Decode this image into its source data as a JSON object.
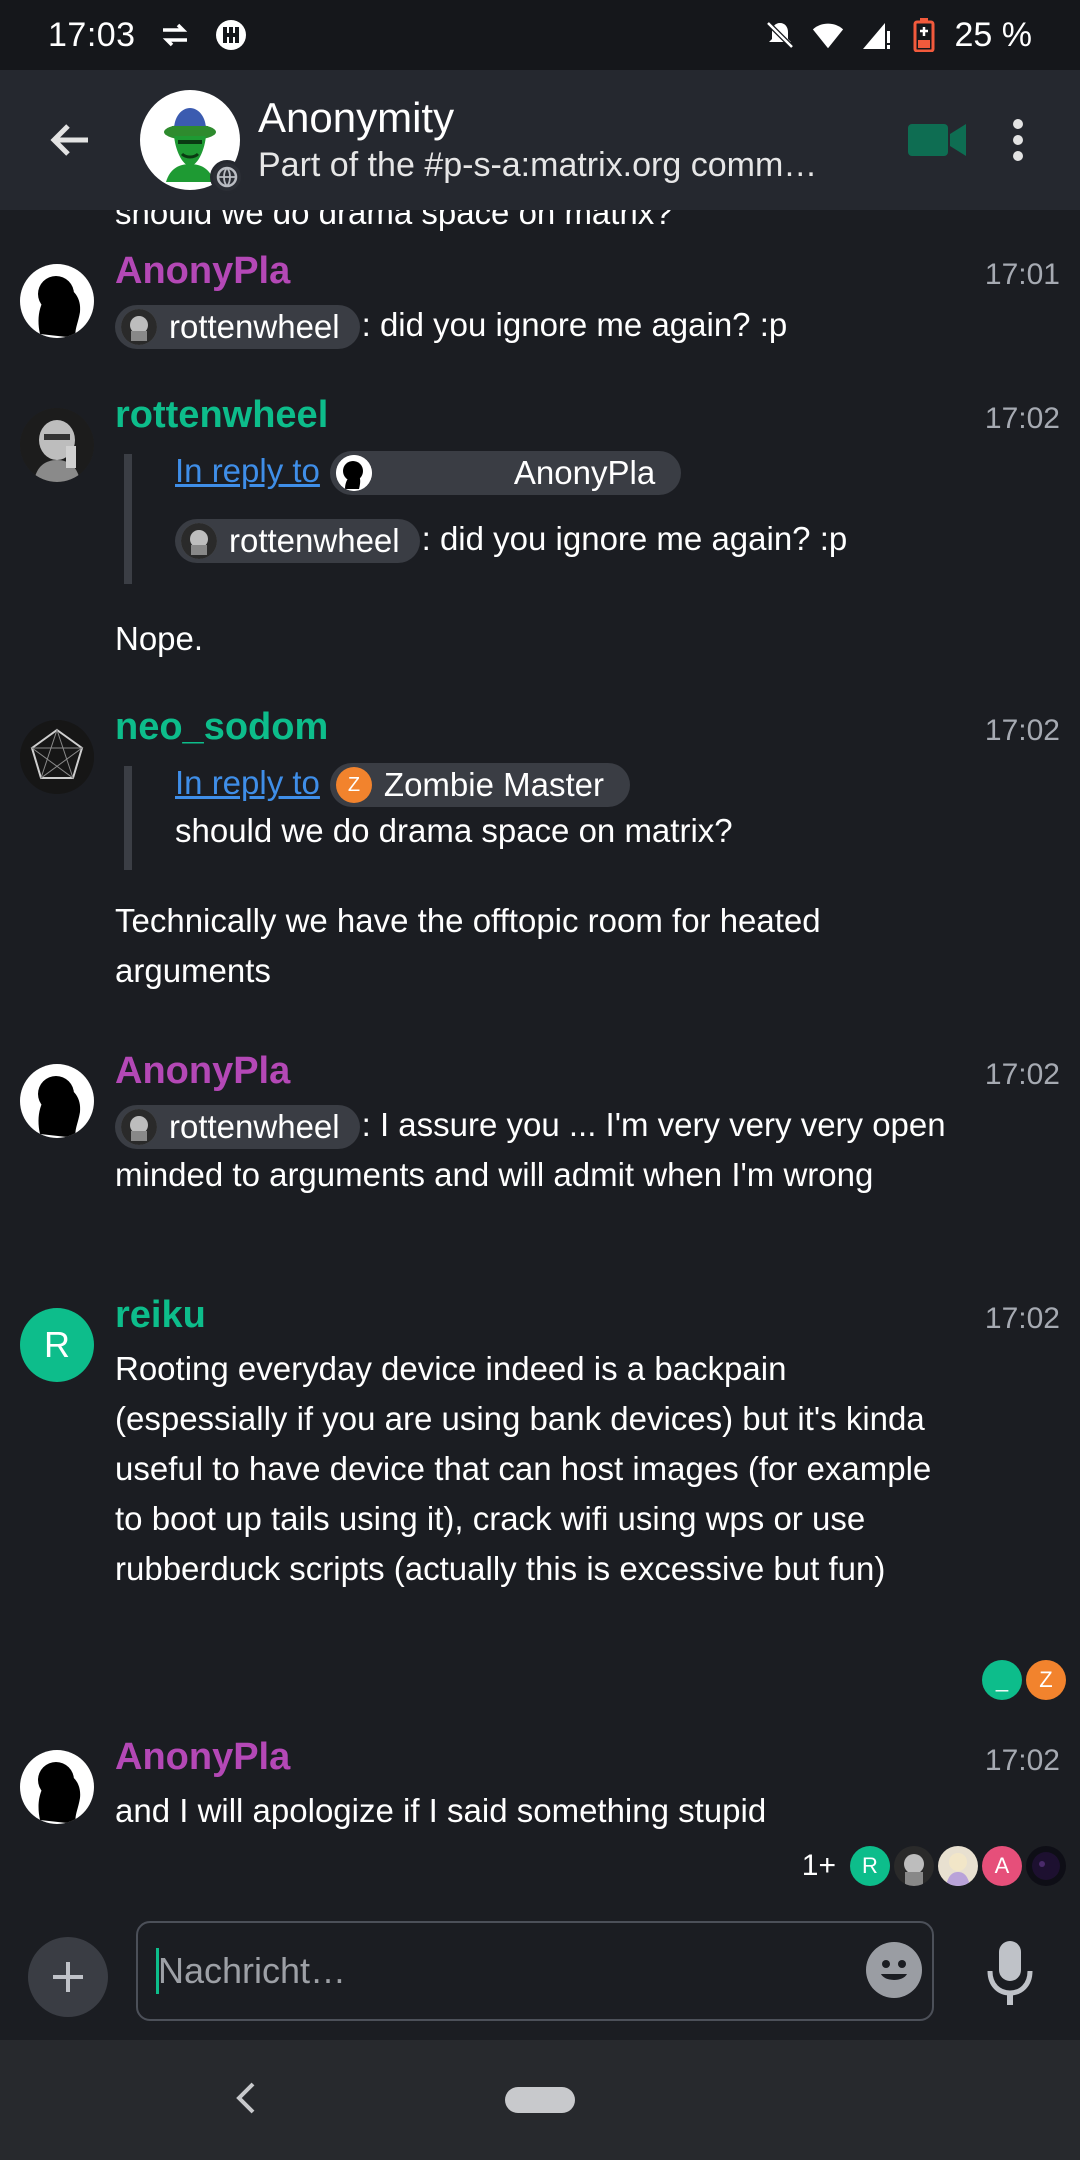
{
  "status_bar": {
    "time": "17:03",
    "battery": "25 %"
  },
  "header": {
    "room_name": "Anonymity",
    "topic": "Part of the #p-s-a:matrix.org comm…"
  },
  "timeline": {
    "cut_text": "should we do drama space on matrix?",
    "messages": [
      {
        "sender": "AnonyPla",
        "time": "17:01",
        "mention": "rottenwheel",
        "text": ": did you ignore me again? :p"
      },
      {
        "sender": "rottenwheel",
        "time": "17:02",
        "reply_link": "In reply to",
        "reply_sender": "AnonyPla",
        "reply_mention": "rottenwheel",
        "reply_text": ": did you ignore me again? :p",
        "text": "Nope."
      },
      {
        "sender": "neo_sodom",
        "time": "17:02",
        "reply_link": "In reply to",
        "reply_sender": "Zombie Master",
        "reply_sender_initial": "Z",
        "reply_text": "should we do drama space on matrix?",
        "text": "Technically we have the offtopic room for heated arguments"
      },
      {
        "sender": "AnonyPla",
        "time": "17:02",
        "mention": "rottenwheel",
        "text": ": I assure you ... I'm very very very open minded to arguments and will admit when I'm wrong"
      },
      {
        "sender": "reiku",
        "time": "17:02",
        "avatar_initial": "R",
        "text": "Rooting everyday device indeed is a backpain (espessially if you are using bank devices) but it's kinda useful to have device that can host images (for example to boot up tails using it), crack wifi using wps or use rubberduck scripts (actually this is excessive but fun)",
        "receipts": [
          "_",
          "Z"
        ]
      },
      {
        "sender": "AnonyPla",
        "time": "17:02",
        "text": "and I will apologize if I said something stupid",
        "receipts_more": "1+",
        "receipts": [
          "R",
          "",
          "",
          "A",
          ""
        ]
      }
    ]
  },
  "composer": {
    "placeholder": "Nachricht…"
  },
  "colors": {
    "anonypla": "#b448b6",
    "green_user": "#0dbd8b",
    "link": "#3f8ee8",
    "zombie_orange": "#f2832d",
    "pink": "#e64f7a"
  }
}
